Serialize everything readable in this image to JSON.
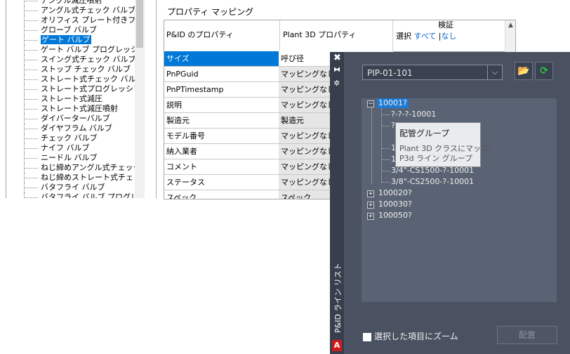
{
  "tree": {
    "items": [
      {
        "label": "アングル減圧噴射"
      },
      {
        "label": "アングル式チェック バルブ"
      },
      {
        "label": "オリフィス プレート付きフロー"
      },
      {
        "label": "グローブ バルブ"
      },
      {
        "label": "ゲート バルブ",
        "selected": true
      },
      {
        "label": "ゲート バルブ プログレッシブ記"
      },
      {
        "label": "スイング式チェック バルブ"
      },
      {
        "label": "ストップ チェック バルブ"
      },
      {
        "label": "ストレート式チェック バルブ"
      },
      {
        "label": "ストレート式プログレッシブ調"
      },
      {
        "label": "ストレート式減圧"
      },
      {
        "label": "ストレート式減圧噴射"
      },
      {
        "label": "ダイバーターバルブ"
      },
      {
        "label": "ダイヤフラム バルブ"
      },
      {
        "label": "チェック バルブ"
      },
      {
        "label": "ナイフ バルブ"
      },
      {
        "label": "ニードル バルブ"
      },
      {
        "label": "ねじ締めアングル式チェック /"
      },
      {
        "label": "ねじ締めストレート式チェック"
      },
      {
        "label": "バタフライ バルブ"
      },
      {
        "label": "バタフライ バルブ プログレッシ"
      }
    ]
  },
  "mapping": {
    "title": "プロパティ マッピング",
    "header": {
      "pid": "P&ID のプロパティ",
      "plant3d": "Plant 3D プロパティ",
      "verify": "検証",
      "select": "選択",
      "all": "すべて",
      "sep": "|",
      "none": "なし"
    },
    "rows": [
      {
        "pid": "サイズ",
        "plant3d": "呼び径",
        "selected": true
      },
      {
        "pid": "PnPGuid",
        "plant3d": "マッピングなし"
      },
      {
        "pid": "PnPTimestamp",
        "plant3d": "マッピングなし"
      },
      {
        "pid": "説明",
        "plant3d": "マッピングなし"
      },
      {
        "pid": "製造元",
        "plant3d": "製造元"
      },
      {
        "pid": "モデル番号",
        "plant3d": "マッピングなし"
      },
      {
        "pid": "納入業者",
        "plant3d": "マッピングなし"
      },
      {
        "pid": "コメント",
        "plant3d": "マッピングなし"
      },
      {
        "pid": "ステータス",
        "plant3d": "マッピングなし"
      },
      {
        "pid": "スペック",
        "plant3d": "スペック"
      }
    ]
  },
  "palette": {
    "close_icon": "✖",
    "autohide_icon": "⧓",
    "props_icon": "✲",
    "vertical_title": "P&ID ライン リスト",
    "logo": "A",
    "dropdown_value": "PIP-01-101",
    "dropdown_arrow": "⌵",
    "open_icon": "📂",
    "refresh_icon": "⟳",
    "tree": [
      {
        "label": "10001?",
        "expander": "−",
        "selected": true
      },
      {
        "label": "?-?-?-10001"
      },
      {
        "label": "?"
      },
      {
        "label": "1"
      },
      {
        "label": "1"
      },
      {
        "label": "3/4\"-CS1500-?-10001"
      },
      {
        "label": "3/8\"-CS2500-?-10001"
      },
      {
        "label": "100020?",
        "expander": "+"
      },
      {
        "label": "100030?",
        "expander": "+"
      },
      {
        "label": "100050?",
        "expander": "+"
      }
    ],
    "tooltip": {
      "title": "配管グループ",
      "line1": "Plant 3D クラスにマップ:",
      "line2": "P3d ライン グループ"
    },
    "zoom_label": "選択した項目にズーム",
    "place_button": "配置"
  },
  "colors": {
    "palette_bg": "#4a5262",
    "tree_bg": "#5a6373",
    "selection": "#0078d7",
    "refresh": "#27c24a"
  }
}
